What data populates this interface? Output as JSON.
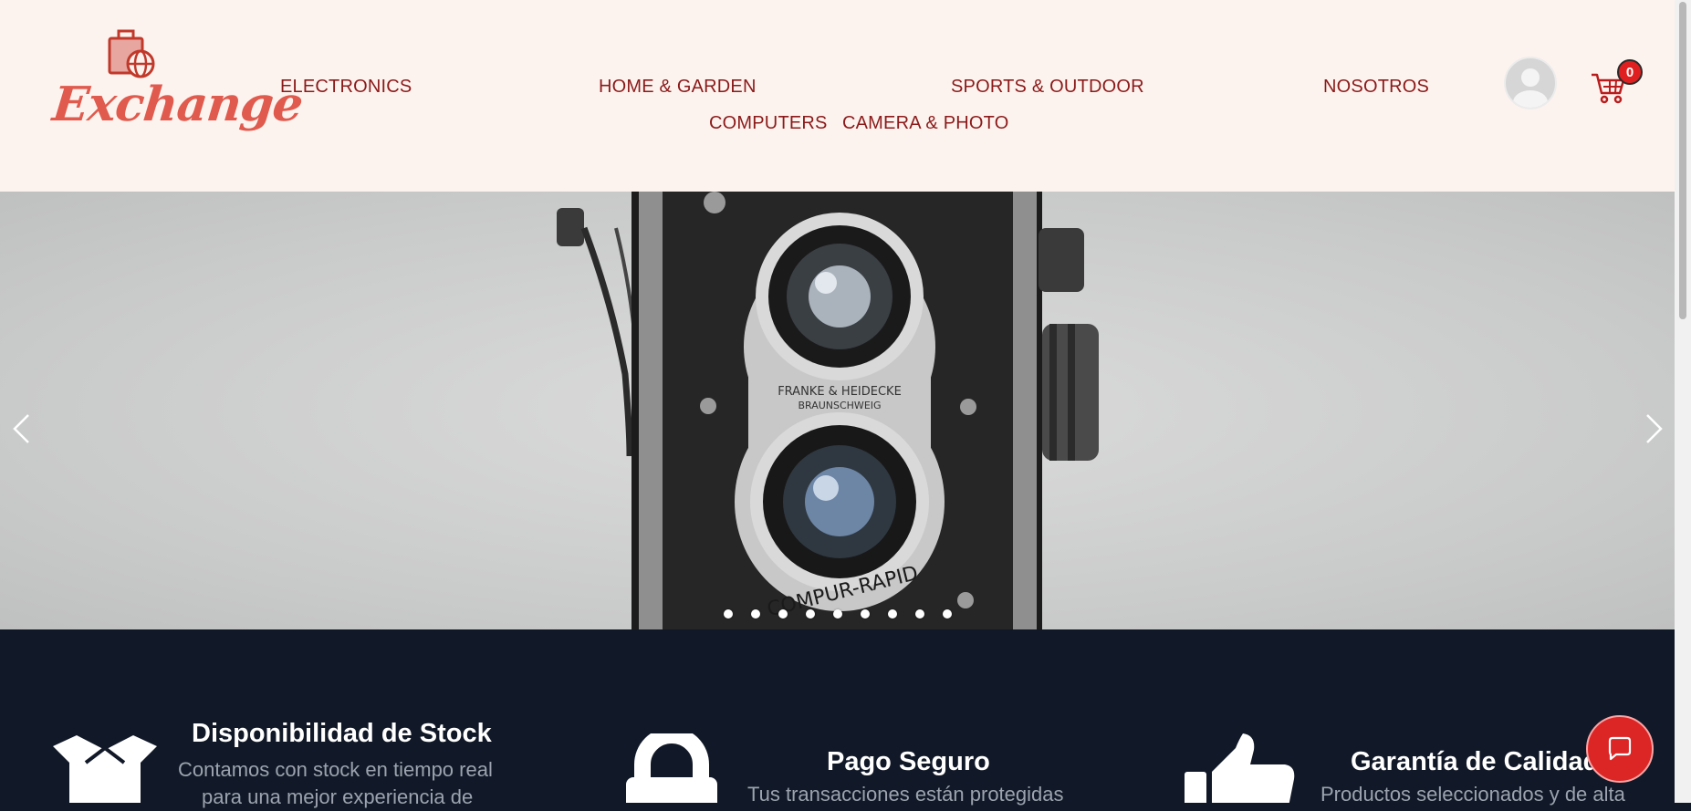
{
  "brand": {
    "name": "Exchange"
  },
  "nav": {
    "electronics": "ELECTRONICS",
    "home_garden": "HOME & GARDEN",
    "sports_outdoor": "SPORTS & OUTDOOR",
    "nosotros": "NOSOTROS",
    "computers": "COMPUTERS",
    "camera_photo": "CAMERA & PHOTO"
  },
  "cart": {
    "count": "0"
  },
  "carousel": {
    "slide_count": 9,
    "active_index": 0,
    "prev_icon": "chevron-left-icon",
    "next_icon": "chevron-right-icon"
  },
  "features": [
    {
      "title": "Disponibilidad de Stock",
      "text_line1": "Contamos con stock en tiempo real",
      "text_line2": "para una mejor experiencia de",
      "icon": "box-icon"
    },
    {
      "title": "Pago Seguro",
      "text_line1": "Tus transacciones están protegidas",
      "icon": "lock-icon"
    },
    {
      "title": "Garantía de Calidad",
      "text_line1": "Productos seleccionados y de alta",
      "icon": "thumbs-up-icon"
    }
  ],
  "colors": {
    "header_bg": "#fdf3ee",
    "nav_text": "#8b1a1a",
    "brand": "#e05a4e",
    "footer_bg": "#111827",
    "accent": "#dc2626"
  }
}
